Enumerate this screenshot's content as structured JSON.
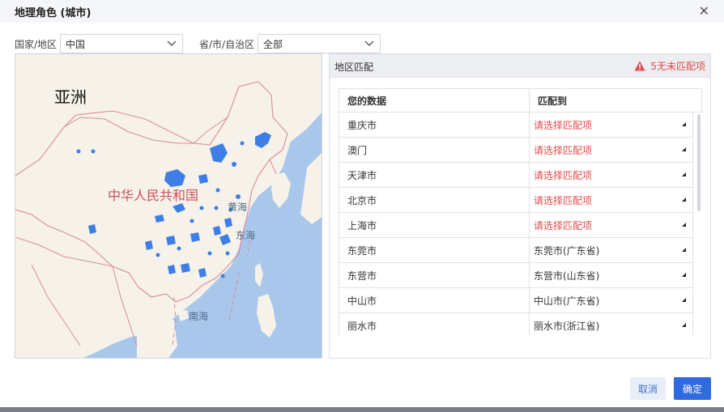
{
  "dialog": {
    "title": "地理角色 (城市)",
    "close_icon": "close-icon"
  },
  "filters": {
    "country_label": "国家/地区",
    "country_value": "中国",
    "province_label": "省/市/自治区",
    "province_value": "全部"
  },
  "map": {
    "continent_label": "亚洲",
    "country_label": "中华人民共和国",
    "sea_labels": [
      "黄海",
      "东海",
      "南海"
    ]
  },
  "panel": {
    "title": "地区匹配",
    "warning": "5无未匹配项",
    "warning_icon": "warning-icon",
    "col_data": "您的数据",
    "col_match": "匹配到"
  },
  "rows": [
    {
      "data": "重庆市",
      "match": "请选择匹配项",
      "status": "unmatched"
    },
    {
      "data": "澳门",
      "match": "请选择匹配项",
      "status": "unmatched"
    },
    {
      "data": "天津市",
      "match": "请选择匹配项",
      "status": "unmatched"
    },
    {
      "data": "北京市",
      "match": "请选择匹配项",
      "status": "unmatched"
    },
    {
      "data": "上海市",
      "match": "请选择匹配项",
      "status": "unmatched"
    },
    {
      "data": "东莞市",
      "match": "东莞市(广东省)",
      "status": "matched"
    },
    {
      "data": "东营市",
      "match": "东营市(山东省)",
      "status": "matched"
    },
    {
      "data": "中山市",
      "match": "中山市(广东省)",
      "status": "matched"
    },
    {
      "data": "丽水市",
      "match": "丽水市(浙江省)",
      "status": "matched"
    }
  ],
  "footer": {
    "cancel_label": "取消",
    "ok_label": "确定"
  },
  "colors": {
    "accent": "#2f6bdf",
    "error": "#e14b4b",
    "sea": "#a8c7ea",
    "land": "#f6f2e9",
    "highlight": "#3d7fe6"
  }
}
